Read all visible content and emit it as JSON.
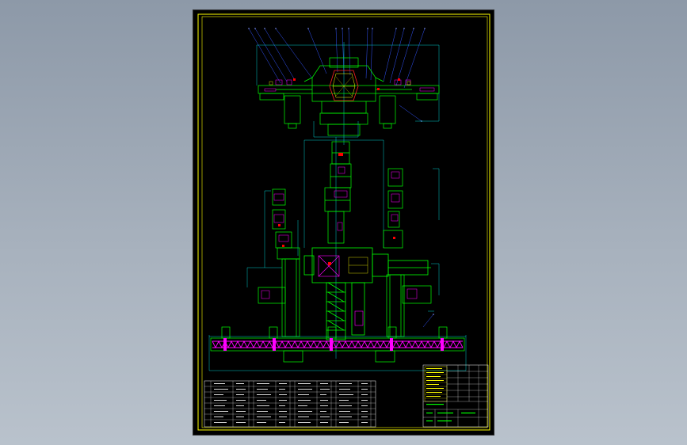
{
  "drawing": {
    "title_block_label": "",
    "parts_list_label": ""
  },
  "colors": {
    "background": "#000000",
    "frame": "#ffff00",
    "dimension": "#00ffff",
    "outline": "#00ff00",
    "hatch": "#ff00ff",
    "leader": "#0000ff",
    "text": "#ffffff",
    "red": "#ff0000"
  }
}
